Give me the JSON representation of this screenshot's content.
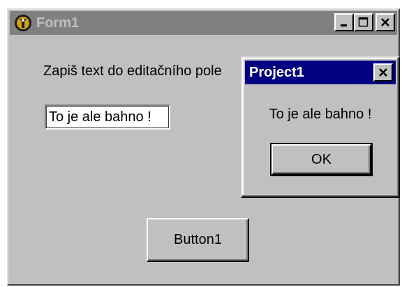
{
  "window": {
    "title": "Form1",
    "controls": {
      "minimize": "minimize-icon",
      "maximize": "maximize-icon",
      "close": "close-icon"
    }
  },
  "form": {
    "label_text": "Zapiš text do editačního pole",
    "edit_value": "To je ale bahno !",
    "button_label": "Button1"
  },
  "dialog": {
    "title": "Project1",
    "message": "To je ale bahno !",
    "ok_label": "OK"
  },
  "colors": {
    "window_face": "#c0c0c0",
    "inactive_titlebar": "#808080",
    "active_titlebar": "#000080"
  }
}
